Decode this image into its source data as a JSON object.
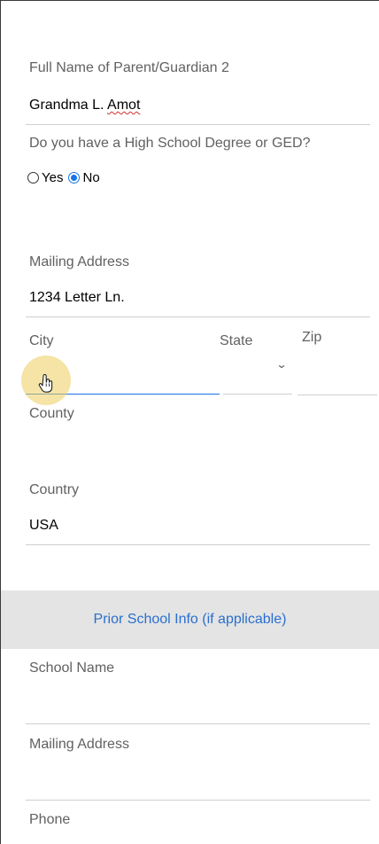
{
  "parent2": {
    "label": "Full Name of Parent/Guardian 2",
    "value_first": "Grandma L. ",
    "value_last": "Amot"
  },
  "hs_degree": {
    "question": "Do you have a High School Degree or GED?",
    "options": [
      {
        "label": "Yes",
        "checked": false
      },
      {
        "label": "No",
        "checked": true
      }
    ]
  },
  "mailing": {
    "label": "Mailing Address",
    "value": "1234 Letter Ln."
  },
  "city": {
    "label": "City",
    "value": ""
  },
  "state": {
    "label": "State",
    "value": ""
  },
  "zip": {
    "label": "Zip",
    "value": ""
  },
  "county": {
    "label": "County",
    "value": ""
  },
  "country": {
    "label": "Country",
    "value": "USA"
  },
  "prior_school": {
    "header": "Prior School Info (if applicable)",
    "school_name_label": "School Name",
    "mailing_label": "Mailing Address",
    "phone_label": "Phone"
  },
  "icons": {
    "state_dropdown": "chevron-down-icon",
    "cursor": "hand-pointer-icon"
  },
  "colors": {
    "accent": "#1a73e8",
    "section_bg": "#e4e4e4",
    "section_text": "#2a6fd0",
    "cursor_halo": "#eece5c"
  }
}
